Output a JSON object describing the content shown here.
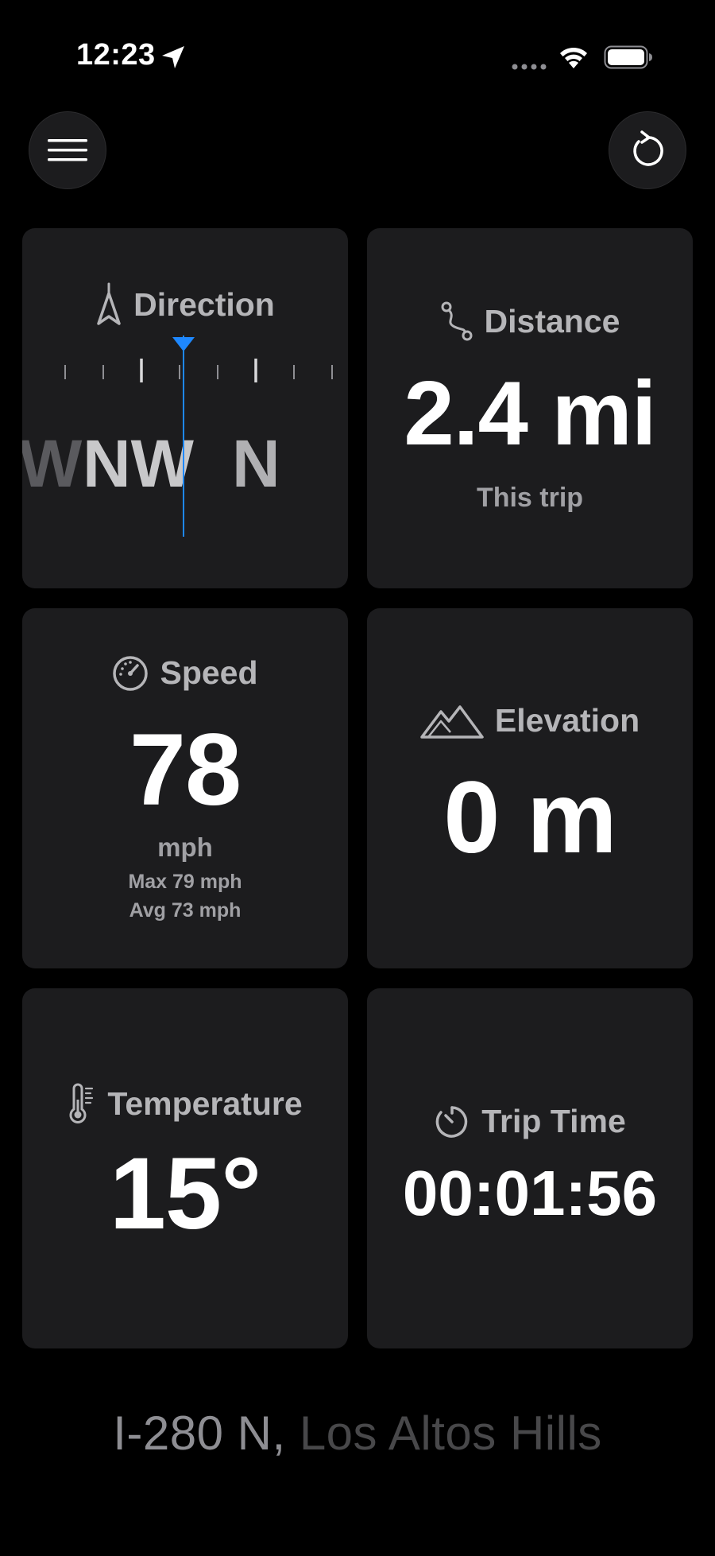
{
  "status_bar": {
    "time": "12:23"
  },
  "header": {
    "menu_icon": "hamburger-menu-icon",
    "reset_icon": "reset-arrow-icon"
  },
  "cards": {
    "direction": {
      "label": "Direction",
      "icon": "compass-arrow-icon",
      "letters": {
        "left_partial": "W",
        "main": "NW",
        "next": "N"
      }
    },
    "distance": {
      "label": "Distance",
      "icon": "route-icon",
      "value": "2.4 mi",
      "caption": "This trip"
    },
    "speed": {
      "label": "Speed",
      "icon": "speedometer-icon",
      "value": "78",
      "unit": "mph",
      "max": "Max 79 mph",
      "avg": "Avg 73 mph"
    },
    "elevation": {
      "label": "Elevation",
      "icon": "mountains-icon",
      "value": "0 m"
    },
    "temperature": {
      "label": "Temperature",
      "icon": "thermometer-icon",
      "value": "15°"
    },
    "trip_time": {
      "label": "Trip Time",
      "icon": "timer-icon",
      "value": "00:01:56"
    }
  },
  "location": {
    "road": "I-280 N",
    "separator": ",",
    "city": "Los Altos Hills"
  },
  "colors": {
    "background": "#000000",
    "card": "#1c1c1e",
    "accent": "#1e88ff",
    "label": "#b5b5b8"
  }
}
